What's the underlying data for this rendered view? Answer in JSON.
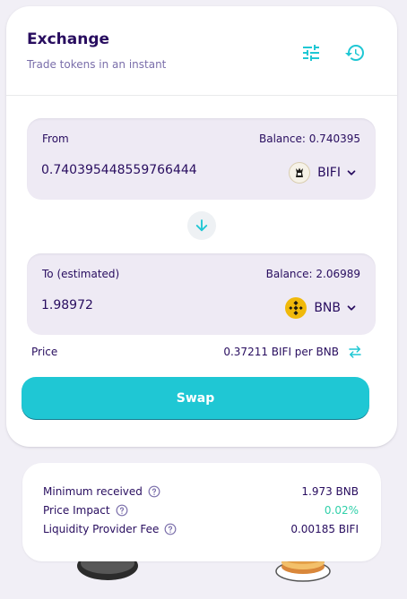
{
  "header": {
    "title": "Exchange",
    "subtitle": "Trade tokens in an instant",
    "icons": [
      "settings-sliders-icon",
      "history-icon"
    ]
  },
  "from": {
    "label": "From",
    "balance": "Balance: 0.740395",
    "amount": "0.740395448559766444",
    "token": "BIFI",
    "token_icon": "bifi-logo-icon"
  },
  "to": {
    "label": "To (estimated)",
    "balance": "Balance: 2.06989",
    "amount": "1.98972",
    "token": "BNB",
    "token_icon": "bnb-logo-icon"
  },
  "price": {
    "label": "Price",
    "value": "0.37211 BIFI per BNB"
  },
  "swap_button": "Swap",
  "details": {
    "minimum_received_label": "Minimum received",
    "minimum_received_value": "1.973 BNB",
    "price_impact_label": "Price Impact",
    "price_impact_value": "0.02%",
    "lp_fee_label": "Liquidity Provider Fee",
    "lp_fee_value": "0.00185 BIFI"
  },
  "colors": {
    "primary": "#1fc7d4",
    "text": "#280d5f",
    "text_subtle": "#7a6eaa",
    "success": "#31d0aa",
    "input_bg": "#eeeaf4",
    "bnb": "#f0b90b"
  }
}
